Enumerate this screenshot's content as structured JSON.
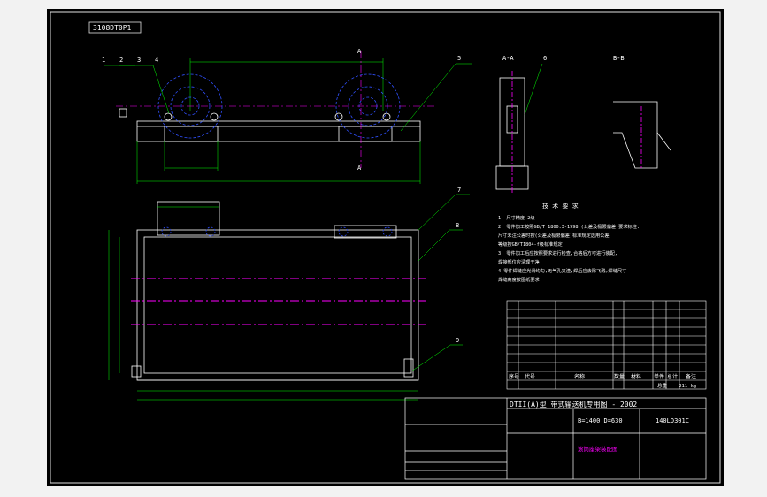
{
  "drawing": {
    "code_box": "3108DT0P1",
    "part_numbers": [
      "1",
      "2",
      "3",
      "4"
    ],
    "part_number_5": "5",
    "part_number_6": "6",
    "part_number_7": "7",
    "part_number_8": "8",
    "part_number_9": "9",
    "section_a": "A",
    "section_view_a": "A-A",
    "section_view_b": "B-B",
    "tech_title": "技 术 要 求",
    "tech_notes": [
      "1. 尺寸精度 2级",
      "2. 零件加工按照GB/T 1800.3-1998 (公差及极限偏差)要求标注.",
      "   尺寸未注公差时按(公差及极限偏差)标准规定选用公差",
      "   等级按GB/T1804-f级标准规定.",
      "3. 零件加工后应按照要求进行检查,合格后方可进行装配,",
      "   焊接部位应清理干净.",
      "4.零件焊缝应光滑均匀,无气孔夹渣,焊后应去除飞溅,焊缝尺寸",
      "   焊缝高度按图纸要求."
    ],
    "title_main": "DTII(A)型 带式输送机专用图 - 2002",
    "title_params": "B=1400  D=630",
    "title_code": "140LD301C",
    "title_name": "滚筒座架装配图",
    "bom_header": [
      "序号",
      "代号",
      "名称",
      "数量",
      "材料",
      "单件",
      "总计",
      "备注"
    ],
    "bom_footer": "总重 -- 211 kg"
  }
}
